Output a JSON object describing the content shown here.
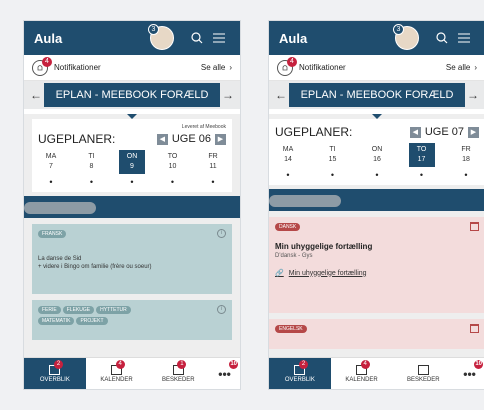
{
  "app": {
    "logo": "Aula",
    "avatar_count": "3"
  },
  "notifications": {
    "label": "Notifikationer",
    "badge": "4",
    "see_all": "Se alle",
    "chevron": "›"
  },
  "carousel": {
    "title": "EPLAN - MEEBOOK FORÆLD",
    "left": "←",
    "right": "→"
  },
  "screen1": {
    "provided_by": "Leveret af Meebook",
    "week_label": "UGEPLANER:",
    "week": "UGE 06",
    "days": [
      {
        "name": "MA",
        "num": "7"
      },
      {
        "name": "TI",
        "num": "8"
      },
      {
        "name": "ON",
        "num": "9"
      },
      {
        "name": "TO",
        "num": "10"
      },
      {
        "name": "FR",
        "num": "11"
      }
    ],
    "lesson1": {
      "tag": "FRANSK",
      "desc": "La danse de Sid\n+ videre i Bingo om familie (frère ou soeur)"
    },
    "lesson2": {
      "tags": [
        "FERIE",
        "FLEKUGE",
        "HYTTETUR",
        "MATEMATIK",
        "PROJEKT"
      ]
    }
  },
  "screen2": {
    "week_label": "UGEPLANER:",
    "week": "UGE 07",
    "days": [
      {
        "name": "MA",
        "num": "14"
      },
      {
        "name": "TI",
        "num": "15"
      },
      {
        "name": "ON",
        "num": "16"
      },
      {
        "name": "TO",
        "num": "17"
      },
      {
        "name": "FR",
        "num": "18"
      }
    ],
    "lesson1": {
      "tag": "DANSK",
      "title": "Min uhyggelige fortælling",
      "sub": "D'dansk - Gys",
      "link": "Min uhyggelige fortælling"
    },
    "lesson2": {
      "tag": "ENGELSK"
    }
  },
  "nav": [
    {
      "label": "OVERBLIK",
      "badge": "2"
    },
    {
      "label": "KALENDER",
      "badge": "4"
    },
    {
      "label": "BESKEDER",
      "badge": "1"
    },
    {
      "label": "•••",
      "badge": "10"
    }
  ],
  "colors": {
    "primary": "#1f4d6e",
    "badge": "#c6213e",
    "teal": "#b9d1d3",
    "pink": "#f3dcdc"
  }
}
